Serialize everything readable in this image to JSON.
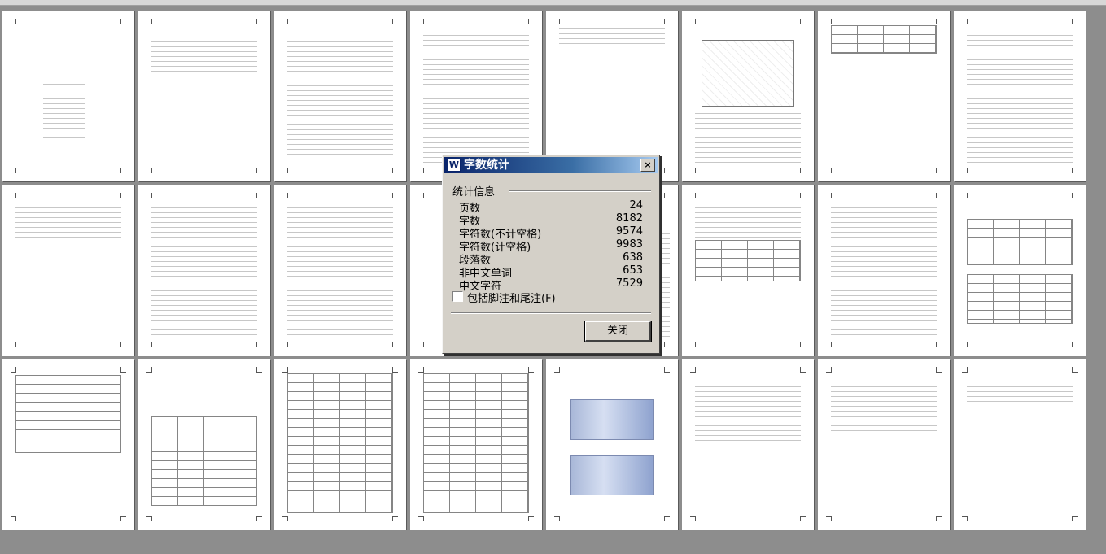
{
  "dialog": {
    "title": "字数统计",
    "group_label": "统计信息",
    "stats": [
      {
        "label": "页数",
        "value": "24"
      },
      {
        "label": "字数",
        "value": "8182"
      },
      {
        "label": "字符数(不计空格)",
        "value": "9574"
      },
      {
        "label": "字符数(计空格)",
        "value": "9983"
      },
      {
        "label": "段落数",
        "value": "638"
      },
      {
        "label": "非中文单词",
        "value": "653"
      },
      {
        "label": "中文字符",
        "value": "7529"
      }
    ],
    "include_footnotes_label": "包括脚注和尾注(F)",
    "include_footnotes_checked": false,
    "close_button_label": "关闭",
    "close_icon": "×"
  }
}
